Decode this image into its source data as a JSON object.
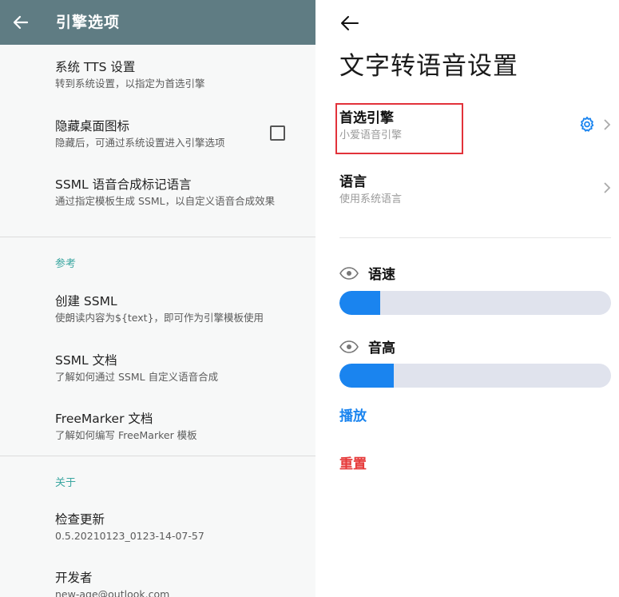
{
  "left": {
    "appbar_title": "引擎选项",
    "items": [
      {
        "title": "系统 TTS 设置",
        "subtitle": "转到系统设置，以指定为首选引擎"
      },
      {
        "title": "隐藏桌面图标",
        "subtitle": "隐藏后，可通过系统设置进入引擎选项"
      },
      {
        "title": "SSML 语音合成标记语言",
        "subtitle": "通过指定模板生成 SSML，以自定义语音合成效果"
      }
    ],
    "section_reference": "参考",
    "reference_items": [
      {
        "title": "创建 SSML",
        "subtitle": "使朗读内容为${text}，即可作为引擎模板使用"
      },
      {
        "title": "SSML 文档",
        "subtitle": "了解如何通过 SSML 自定义语音合成"
      },
      {
        "title": "FreeMarker 文档",
        "subtitle": "了解如何编写 FreeMarker 模板"
      }
    ],
    "section_about": "关于",
    "about_items": [
      {
        "title": "检查更新",
        "subtitle": "0.5.20210123_0123-14-07-57"
      },
      {
        "title": "开发者",
        "subtitle": "new-age@outlook.com"
      }
    ],
    "hide_icon_checked": false
  },
  "right": {
    "title": "文字转语音设置",
    "preferred_engine": {
      "title": "首选引擎",
      "subtitle": "小爱语音引擎"
    },
    "language": {
      "title": "语言",
      "subtitle": "使用系统语言"
    },
    "speech_rate": {
      "label": "语速",
      "value_fraction": 0.15
    },
    "pitch": {
      "label": "音高",
      "value_fraction": 0.2
    },
    "play_label": "播放",
    "reset_label": "重置"
  },
  "colors": {
    "appbar": "#5f7c83",
    "section_accent": "#3aa6a0",
    "link_blue": "#1a84ef",
    "reset_red": "#e63a3a",
    "highlight_red": "#e2323a"
  },
  "icons": [
    "back-arrow-icon",
    "checkbox-icon",
    "gear-icon",
    "chevron-right-icon",
    "eye-icon"
  ]
}
